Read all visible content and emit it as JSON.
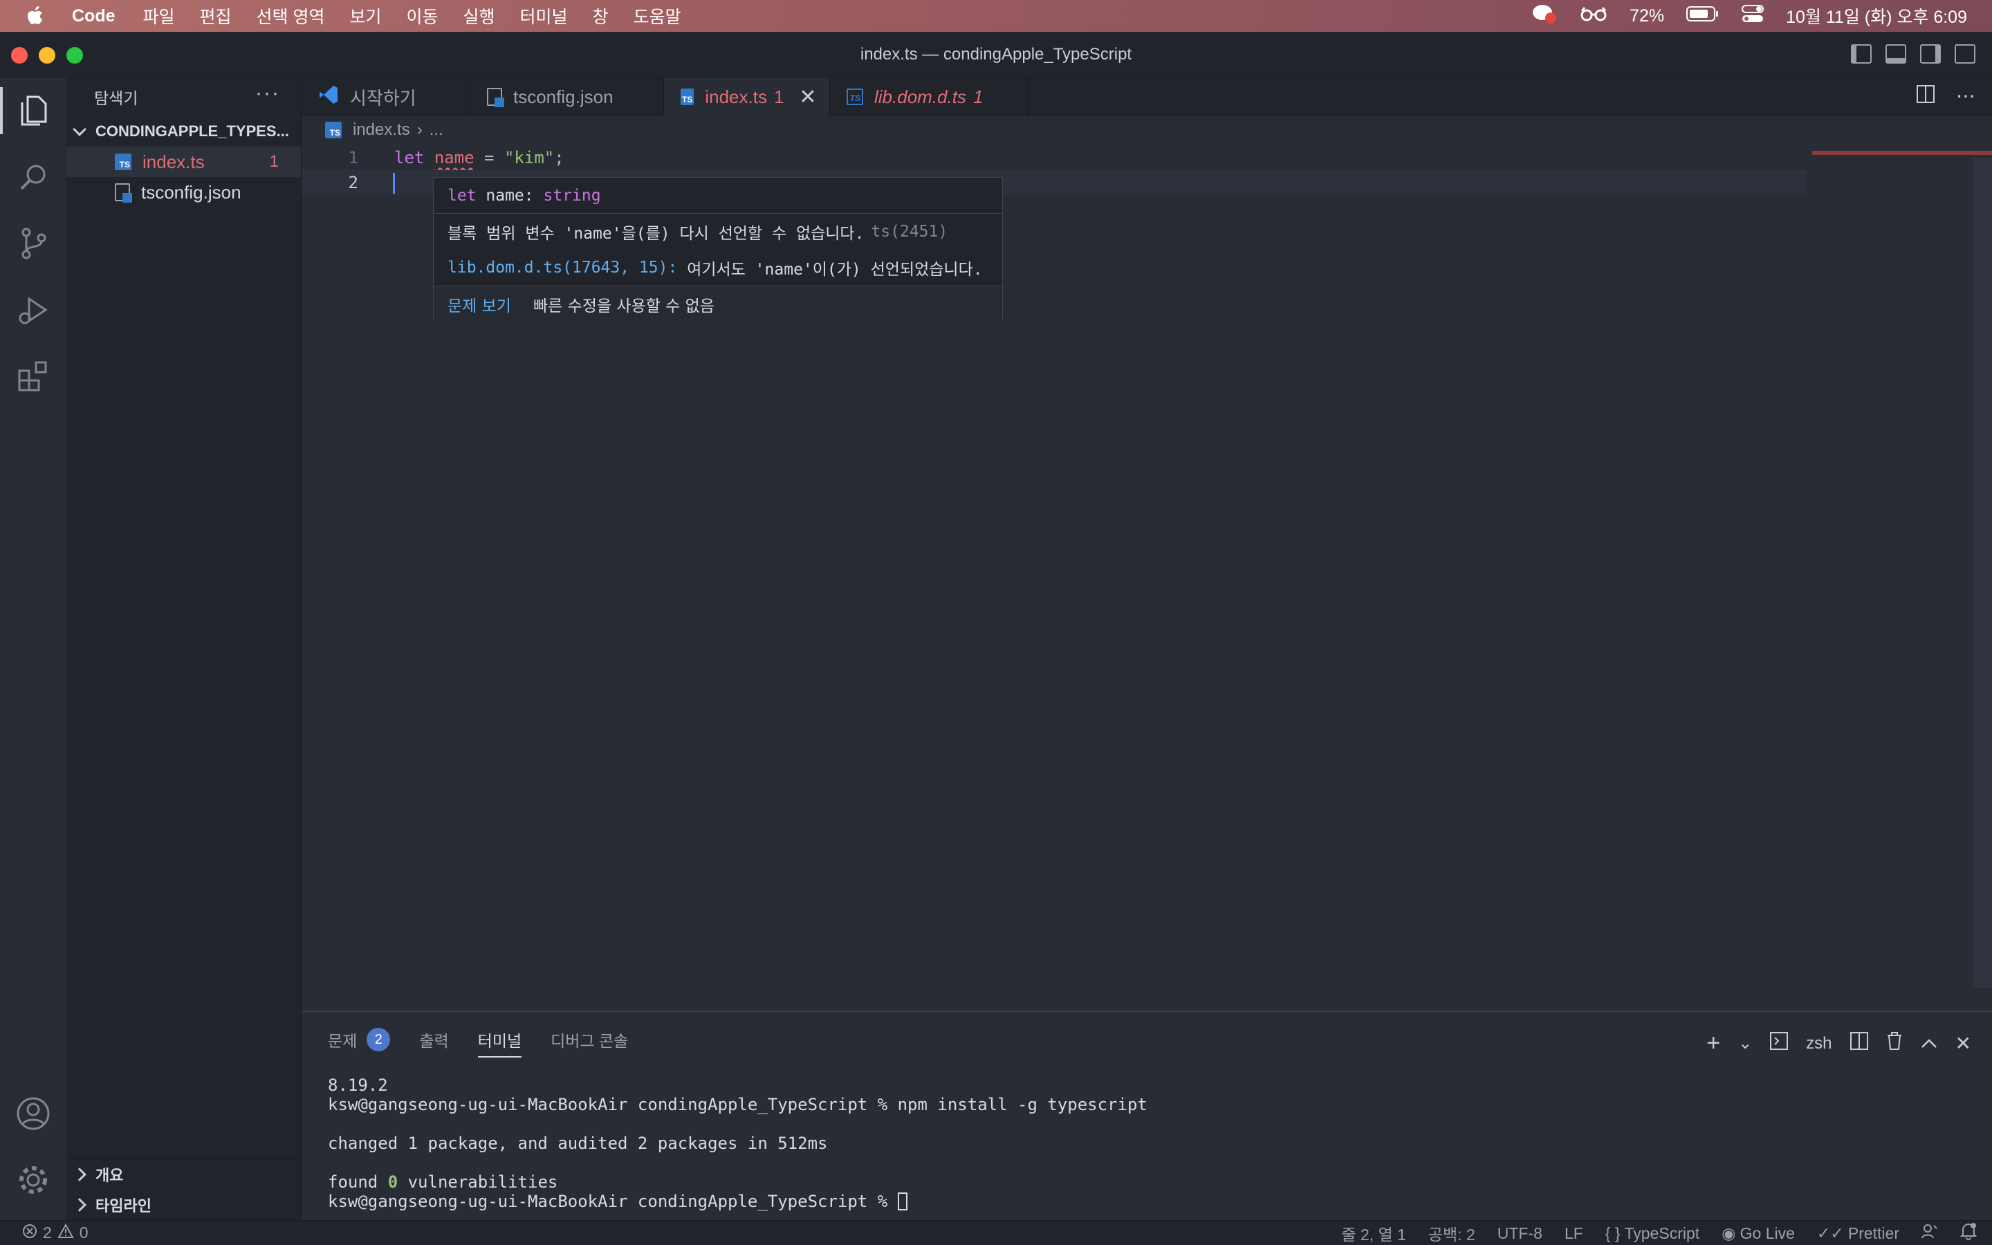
{
  "menubar": {
    "app": "Code",
    "items": [
      "파일",
      "편집",
      "선택 영역",
      "보기",
      "이동",
      "실행",
      "터미널",
      "창",
      "도움말"
    ],
    "battery": "72%",
    "clock": "10월 11일 (화) 오후 6:09"
  },
  "window": {
    "title": "index.ts — condingApple_TypeScript"
  },
  "sidebar": {
    "title": "탐색기",
    "more": "···",
    "folder": "CONDINGAPPLE_TYPES...",
    "files": [
      {
        "name": "index.ts",
        "badge": "1"
      },
      {
        "name": "tsconfig.json",
        "badge": ""
      }
    ],
    "bottom_sections": [
      "개요",
      "타임라인"
    ]
  },
  "tabs": [
    {
      "label": "시작하기",
      "errors": ""
    },
    {
      "label": "tsconfig.json",
      "errors": ""
    },
    {
      "label": "index.ts",
      "errors": "1"
    },
    {
      "label": "lib.dom.d.ts",
      "errors": "1"
    }
  ],
  "breadcrumb": {
    "file": "index.ts",
    "more": "..."
  },
  "editor": {
    "lines": [
      {
        "num": "1",
        "kw": "let",
        "var": "name",
        "op": " = ",
        "str": "\"kim\"",
        "end": ";"
      },
      {
        "num": "2"
      }
    ]
  },
  "hover": {
    "sig_kw": "let",
    "sig_rest": " name: ",
    "sig_type": "string",
    "error_text": "블록 범위 변수 'name'을(를) 다시 선언할 수 없습니다.",
    "error_code": "ts(2451)",
    "related_link": "lib.dom.d.ts(17643, 15):",
    "related_text": " 여기서도 'name'이(가) 선언되었습니다.",
    "action_view": "문제 보기",
    "action_fix": "빠른 수정을 사용할 수 없음"
  },
  "panel": {
    "tabs": [
      "문제",
      "출력",
      "터미널",
      "디버그 콘솔"
    ],
    "problem_count": "2",
    "shell": "zsh",
    "terminal_lines": [
      "8.19.2",
      "ksw@gangseong-ug-ui-MacBookAir condingApple_TypeScript % npm install -g typescript",
      "",
      "changed 1 package, and audited 2 packages in 512ms",
      "",
      "found ",
      "ksw@gangseong-ug-ui-MacBookAir condingApple_TypeScript % "
    ],
    "vuln_count": "0",
    "vuln_text": " vulnerabilities"
  },
  "statusbar": {
    "errors": "2",
    "warnings": "0",
    "position": "줄 2, 열 1",
    "spaces": "공백: 2",
    "encoding": "UTF-8",
    "eol": "LF",
    "language": "TypeScript",
    "golive": "Go Live",
    "prettier": "Prettier"
  },
  "colors": {
    "accent": "#528bff",
    "error": "#e06c75",
    "string": "#98c379",
    "keyword": "#c678dd",
    "link": "#61afef"
  }
}
